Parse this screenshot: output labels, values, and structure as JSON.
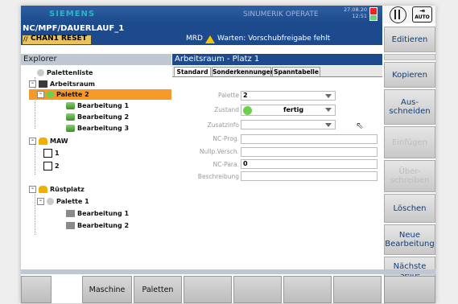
{
  "header": {
    "brand": "SIEMENS",
    "product": "SINUMERIK OPERATE",
    "date": "27.08.20",
    "time": "12:51",
    "mode_label": "AUTO"
  },
  "path": "NC/MPF/DAUERLAUF_1",
  "status": {
    "channel": "CHAN1",
    "channel_state": "RESET",
    "mrd": "MRD",
    "message": "Warten: Vorschubfreigabe fehlt"
  },
  "explorer": {
    "title": "Explorer",
    "items": [
      {
        "label": "Palettenliste"
      },
      {
        "label": "Arbeitsraum"
      },
      {
        "label": "Palette 2"
      },
      {
        "label": "Bearbeitung 1"
      },
      {
        "label": "Bearbeitung 2"
      },
      {
        "label": "Bearbeitung 3"
      },
      {
        "label": "MAW"
      },
      {
        "label": "1"
      },
      {
        "label": "2"
      },
      {
        "label": "Rüstplatz"
      },
      {
        "label": "Palette 1"
      },
      {
        "label": "Bearbeitung 1"
      },
      {
        "label": "Bearbeitung 2"
      }
    ]
  },
  "workarea": {
    "title": "Arbeitsraum - Platz 1",
    "tabs": [
      "Standard",
      "Sonderkennungen",
      "Spanntabelle"
    ],
    "fields": {
      "palette_label": "Palette",
      "palette_value": "2",
      "zustand_label": "Zustand",
      "zustand_value": "fertig",
      "zusatzinfo_label": "Zusatzinfo",
      "ncprog_label": "NC-Prog.",
      "multip_label": "Nullp.Versch.",
      "ncpara_label": "NC-Para.",
      "ncpara_value": "0",
      "beschreibung_label": "Beschreibung"
    }
  },
  "softkeys_right": {
    "editieren": "Editieren",
    "kopieren": "Kopieren",
    "ausschneiden": "Aus-\nschneiden",
    "einfuegen": "Einfügen",
    "ueberschreiben": "Über-\nschreiben",
    "loeschen": "Löschen",
    "neue_bearbeitung": "Neue\nBearbeitung",
    "naechste_seite": "Nächste\nSeite"
  },
  "softkeys_bottom": {
    "maschine": "Maschine",
    "paletten": "Paletten"
  },
  "colors": {
    "header_blue": "#1c4a8c",
    "selection_orange": "#f59a29",
    "channel_yellow": "#e8c25a",
    "softkey_text": "#0f3d7a"
  }
}
